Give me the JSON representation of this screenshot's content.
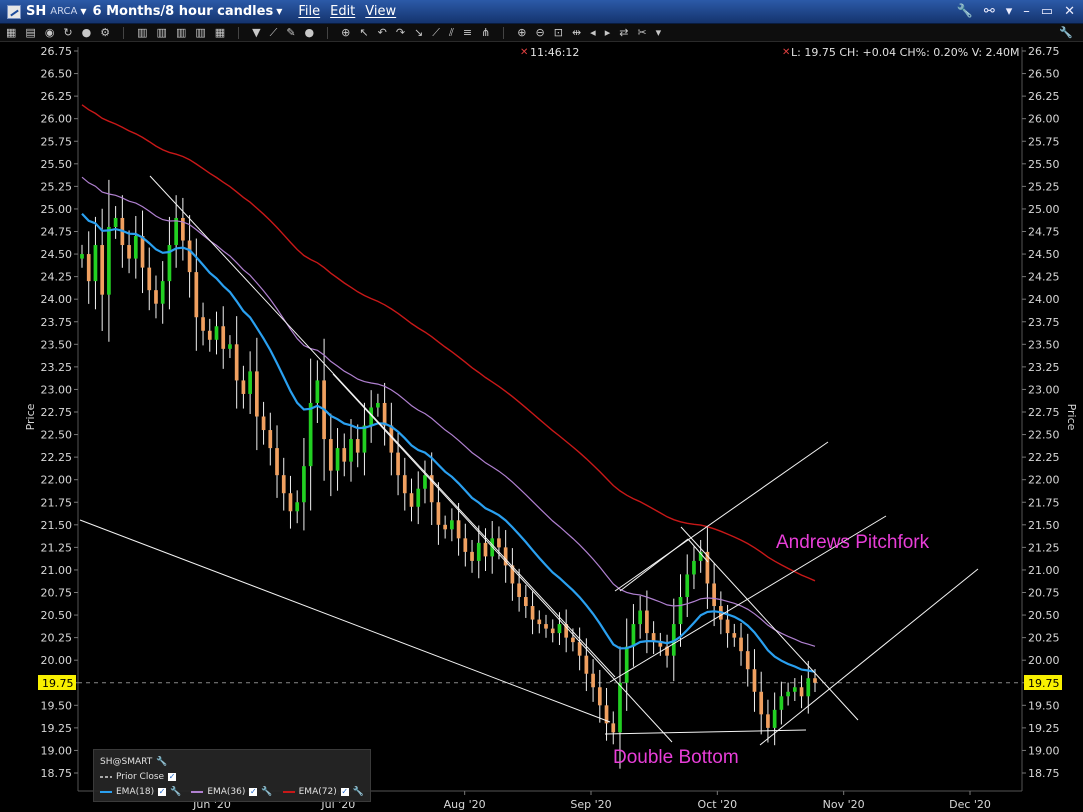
{
  "titlebar": {
    "symbol": "SH",
    "exchange": "ARCA",
    "period": "6 Months/8 hour candles",
    "menus": [
      "File",
      "Edit",
      "View"
    ]
  },
  "header": {
    "time": "11:46:12",
    "quote": "L: 19.75 CH: +0.04 CH%: 0.20% V: 2.40M"
  },
  "annotations": {
    "pitchfork": "Andrews Pitchfork",
    "double_bottom": "Double Bottom"
  },
  "legend": {
    "title": "SH@SMART",
    "prior_close": "Prior Close",
    "ema18": "EMA(18)",
    "ema36": "EMA(36)",
    "ema72": "EMA(72)"
  },
  "colors": {
    "up": "#22d022",
    "down": "#f0a060",
    "ema18": "#2aa0f0",
    "ema36": "#b080d0",
    "ema72": "#c81818",
    "annotation": "#e83ed8",
    "price_tag": "#f8f000"
  },
  "chart_data": {
    "type": "candlestick",
    "ylabel": "Price",
    "ylim": [
      18.75,
      26.75
    ],
    "ytick_labels": [
      "26.75",
      "26.50",
      "26.25",
      "26.00",
      "25.75",
      "25.50",
      "25.25",
      "25.00",
      "24.75",
      "24.50",
      "24.25",
      "24.00",
      "23.75",
      "23.50",
      "23.25",
      "23.00",
      "22.75",
      "22.50",
      "22.25",
      "22.00",
      "21.75",
      "21.50",
      "21.25",
      "21.00",
      "20.75",
      "20.50",
      "20.25",
      "20.00",
      "19.75",
      "19.50",
      "19.25",
      "19.00",
      "18.75"
    ],
    "x_labels": [
      "Jun '20",
      "Jul '20",
      "Aug '20",
      "Sep '20",
      "Oct '20",
      "Nov '20",
      "Dec '20"
    ],
    "last_price": "19.75",
    "closes": [
      24.5,
      24.2,
      24.6,
      24.05,
      24.8,
      24.9,
      24.6,
      24.45,
      24.7,
      24.35,
      24.1,
      23.95,
      24.2,
      24.6,
      24.9,
      24.65,
      24.3,
      23.8,
      23.65,
      23.55,
      23.7,
      23.45,
      23.5,
      23.1,
      22.95,
      23.2,
      22.7,
      22.55,
      22.35,
      22.05,
      21.85,
      21.65,
      21.75,
      22.15,
      22.85,
      23.1,
      22.45,
      22.1,
      22.35,
      22.2,
      22.45,
      22.3,
      22.6,
      22.8,
      22.85,
      22.6,
      22.3,
      22.05,
      21.85,
      21.7,
      21.9,
      22.05,
      21.75,
      21.5,
      21.45,
      21.55,
      21.35,
      21.2,
      21.1,
      21.3,
      21.15,
      21.35,
      21.25,
      21.05,
      20.85,
      20.7,
      20.6,
      20.45,
      20.4,
      20.35,
      20.3,
      20.4,
      20.25,
      20.2,
      20.05,
      19.85,
      19.7,
      19.5,
      19.3,
      19.2,
      19.75,
      20.15,
      20.4,
      20.55,
      20.3,
      20.2,
      20.15,
      20.05,
      20.4,
      20.7,
      20.95,
      21.1,
      21.2,
      20.85,
      20.6,
      20.45,
      20.3,
      20.25,
      20.1,
      19.9,
      19.65,
      19.4,
      19.25,
      19.45,
      19.6,
      19.65,
      19.7,
      19.6,
      19.8,
      19.75
    ],
    "series": [
      {
        "name": "EMA(18)",
        "period": 18
      },
      {
        "name": "EMA(36)",
        "period": 36
      },
      {
        "name": "EMA(72)",
        "period": 72
      }
    ]
  }
}
